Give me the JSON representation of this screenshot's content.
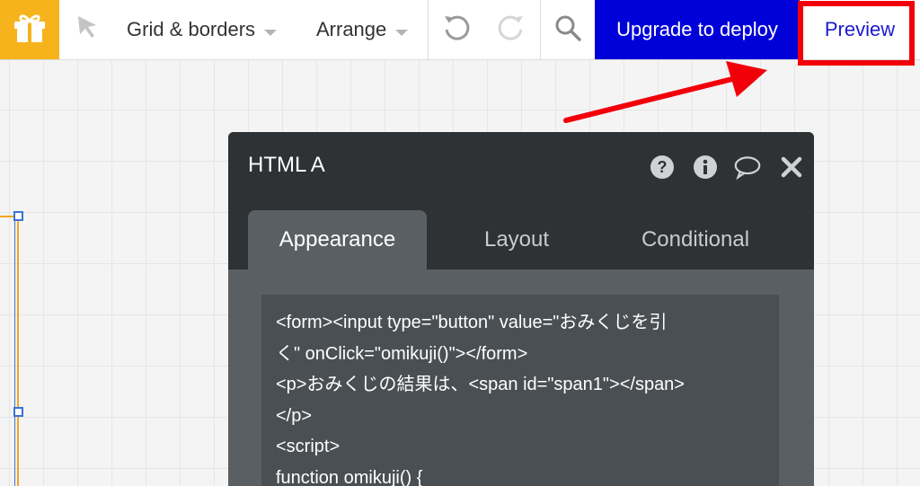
{
  "toolbar": {
    "grid_menu_label": "Grid & borders",
    "arrange_menu_label": "Arrange",
    "upgrade_label": "Upgrade to deploy",
    "preview_label": "Preview",
    "icons": [
      "gift-icon",
      "cursor-icon",
      "undo-icon",
      "redo-icon",
      "search-icon",
      "chevron-down-icon"
    ]
  },
  "colors": {
    "gift_bg": "#f6b31b",
    "upgrade_bg": "#0000d8",
    "preview_text": "#1a1ad0",
    "annotation_red": "#f2000a",
    "panel_header": "#2e3235",
    "panel_body": "#5a5f63"
  },
  "panel": {
    "title": "HTML A",
    "header_icons": [
      "help-icon",
      "info-icon",
      "comment-icon",
      "close-icon"
    ],
    "tabs": [
      {
        "label": "Appearance",
        "active": true
      },
      {
        "label": "Layout",
        "active": false
      },
      {
        "label": "Conditional",
        "active": false
      }
    ],
    "code_lines": [
      "<form><input type=\"button\" value=\"おみくじを引",
      "く\" onClick=\"omikuji()\"></form>",
      "<p>おみくじの結果は、<span id=\"span1\"></span>",
      "</p>",
      "<script>",
      "function omikuji() {"
    ]
  }
}
